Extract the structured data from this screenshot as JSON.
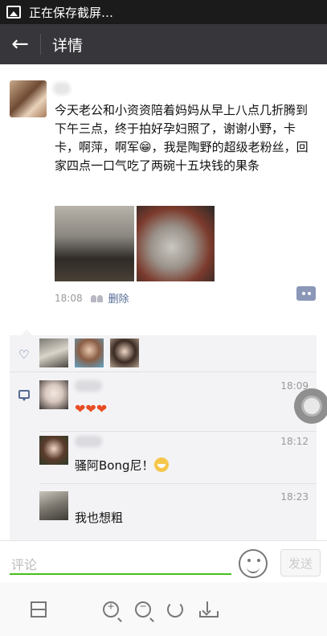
{
  "status_bar": {
    "text": "正在保存截屏…"
  },
  "header": {
    "title": "详情"
  },
  "post": {
    "text": "今天老公和小资资陪着妈妈从早上八点几折腾到下午三点，终于拍好孕妇照了，谢谢小野，卡卡，啊萍，啊军😁，我是陶野的超级老粉丝，回家四点一口气吃了两碗十五块钱的果条",
    "time": "18:08",
    "delete_label": "删除"
  },
  "comments": [
    {
      "time": "18:09",
      "text": "❤❤❤"
    },
    {
      "time": "18:12",
      "text": "骚阿Bong尼！"
    },
    {
      "time": "18:23",
      "text": "我也想粗"
    }
  ],
  "composer": {
    "placeholder": "评论",
    "send_label": "发送"
  },
  "toolbar": {
    "zoom_in_glyph": "+",
    "zoom_out_glyph": "−"
  },
  "colors": {
    "link": "#576b95",
    "accent_green": "#45c01a",
    "header_bg": "#37373b"
  }
}
